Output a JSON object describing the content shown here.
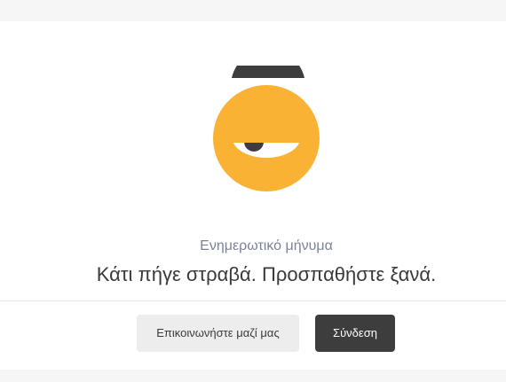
{
  "message": {
    "label": "Ενημερωτικό μήνυμα",
    "text": "Κάτι πήγε στραβά. Προσπαθήστε ξανά."
  },
  "actions": {
    "contact_label": "Επικοινωνήστε μαζί μας",
    "login_label": "Σύνδεση"
  },
  "illustration": {
    "icon": "sleepy-face-icon",
    "colors": {
      "face": "#f9b233",
      "dark": "#3d3d3d",
      "white": "#ffffff"
    }
  },
  "colors": {
    "page_background": "#f6f6f6",
    "card_background": "#ffffff",
    "label_text": "#7a8299",
    "message_text": "#3a3a3a",
    "secondary_button": "#ededed",
    "primary_button": "#3d3d3d"
  }
}
